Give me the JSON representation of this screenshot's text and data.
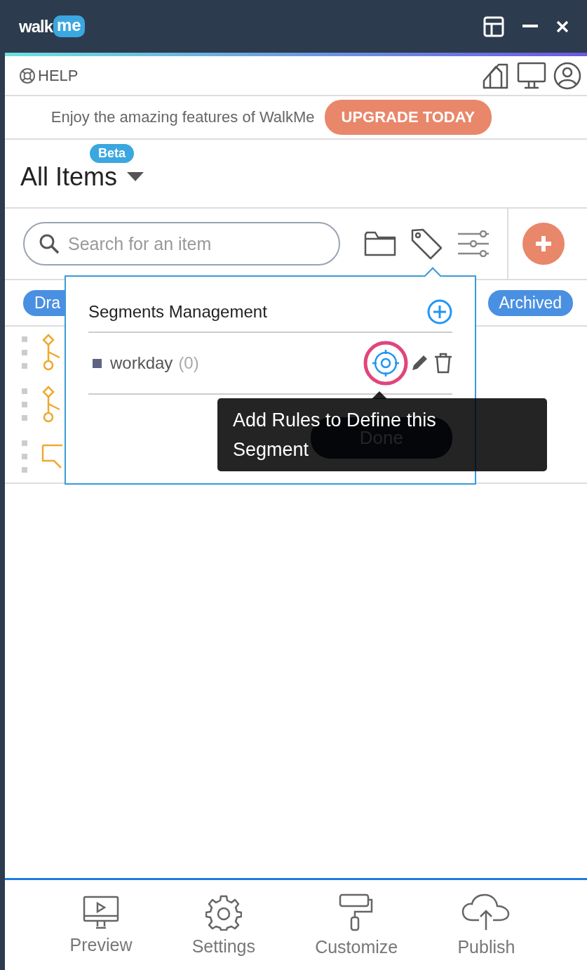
{
  "app": {
    "logo": "walk",
    "logo_badge": "me"
  },
  "help": {
    "label": "HELP"
  },
  "banner": {
    "text": "Enjoy the amazing features of WalkMe",
    "button": "UPGRADE TODAY"
  },
  "view": {
    "title": "All Items",
    "badge": "Beta"
  },
  "search": {
    "placeholder": "Search for an item"
  },
  "filters": [
    {
      "label": "Dra"
    },
    {
      "label": "Archived"
    }
  ],
  "items": [
    {
      "kind": "flow"
    },
    {
      "kind": "flow"
    },
    {
      "kind": "tip"
    }
  ],
  "popover": {
    "title": "Segments Management",
    "segments": [
      {
        "name": "workday",
        "count": "(0)",
        "color": "#5f6383"
      }
    ],
    "done": "Done"
  },
  "tooltip": {
    "text": "Add Rules to Define this Segment"
  },
  "nav": [
    {
      "label": "Preview",
      "kind": "preview"
    },
    {
      "label": "Settings",
      "kind": "settings"
    },
    {
      "label": "Customize",
      "kind": "customize"
    },
    {
      "label": "Publish",
      "kind": "publish"
    }
  ]
}
